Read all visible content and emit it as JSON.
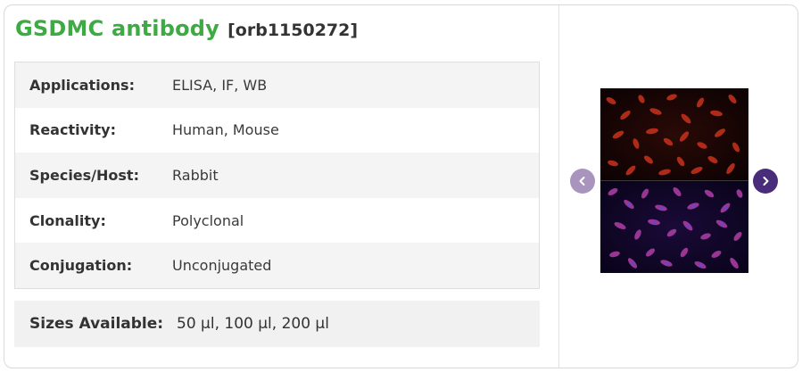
{
  "product": {
    "name": "GSDMC antibody",
    "code": "[orb1150272]"
  },
  "specs": [
    {
      "label": "Applications:",
      "value": "ELISA,  IF,  WB"
    },
    {
      "label": "Reactivity:",
      "value": "Human, Mouse"
    },
    {
      "label": "Species/Host:",
      "value": "Rabbit"
    },
    {
      "label": "Clonality:",
      "value": "Polyclonal"
    },
    {
      "label": "Conjugation:",
      "value": "Unconjugated"
    }
  ],
  "sizes": {
    "label": "Sizes Available:",
    "value": "50 µl, 100 µl, 200 µl"
  },
  "gallery": {
    "prev_icon": "chevron-left-icon",
    "next_icon": "chevron-right-icon"
  },
  "colors": {
    "title_green": "#3eaa43",
    "nav_prev": "#a994bd",
    "nav_next": "#4a2d7a"
  }
}
